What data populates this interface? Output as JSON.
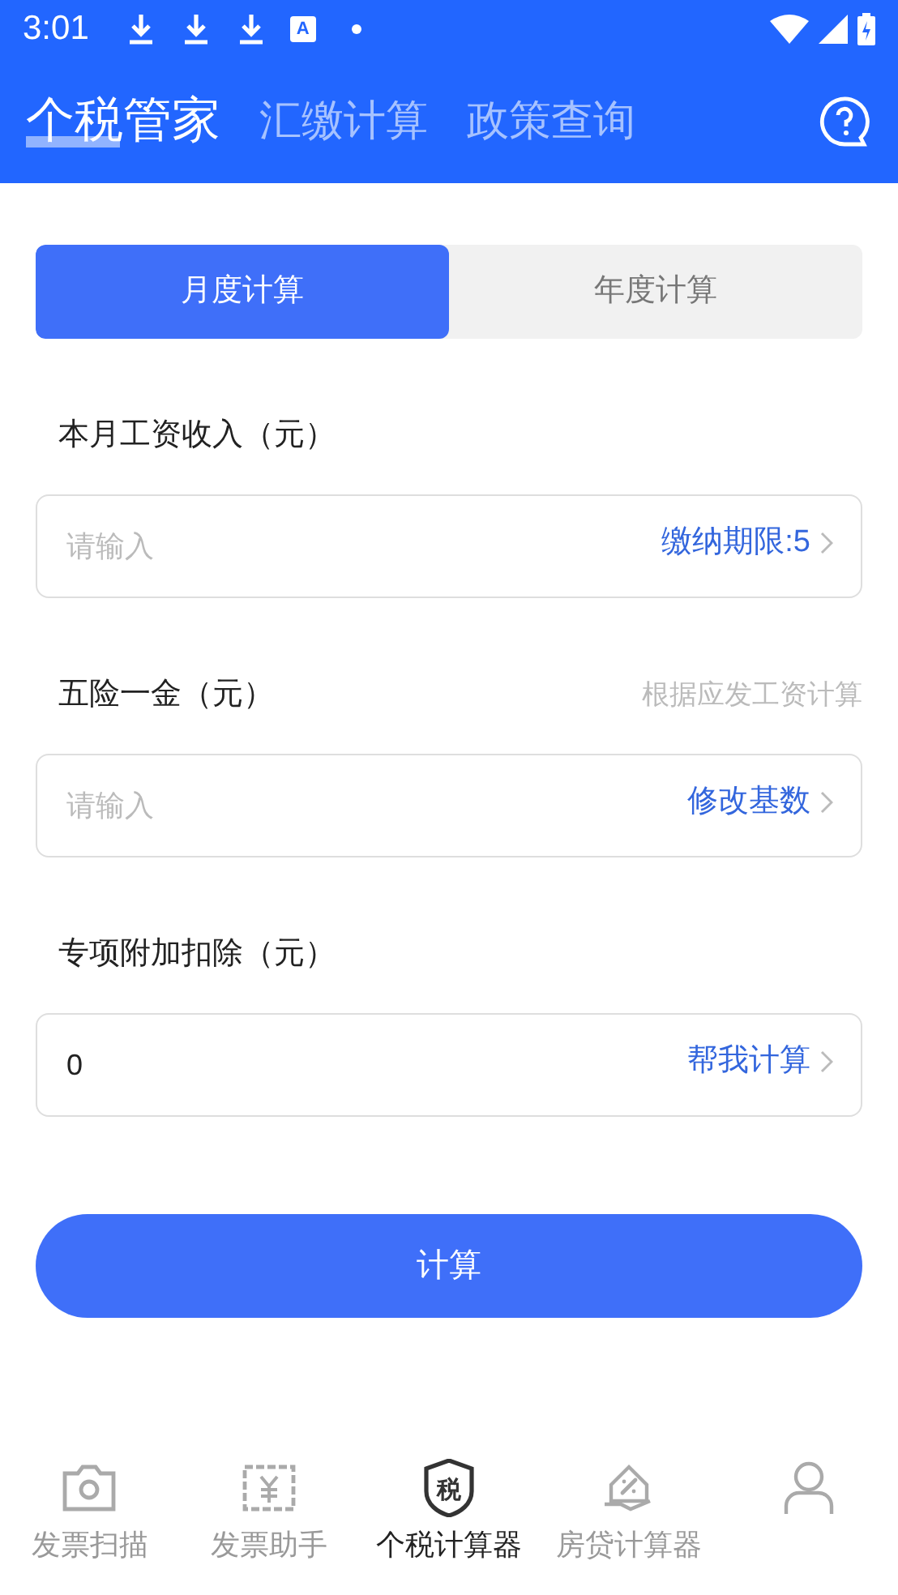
{
  "status_bar": {
    "time": "3:01",
    "notifications": [
      {
        "kind": "download"
      },
      {
        "kind": "download"
      },
      {
        "kind": "download"
      },
      {
        "kind": "app",
        "text": "A"
      },
      {
        "kind": "dot"
      }
    ]
  },
  "header": {
    "tabs": [
      {
        "label": "个税管家",
        "selected": true
      },
      {
        "label": "汇缴计算",
        "selected": false
      },
      {
        "label": "政策查询",
        "selected": false
      }
    ]
  },
  "mode_tabs": [
    {
      "label": "月度计算",
      "selected": true
    },
    {
      "label": "年度计算",
      "selected": false
    }
  ],
  "fields": [
    {
      "label": "本月工资收入（元）",
      "placeholder": "请输入",
      "action": "缴纳期限:5"
    },
    {
      "label": "五险一金（元）",
      "hint": "根据应发工资计算",
      "placeholder": "请输入",
      "action": "修改基数"
    },
    {
      "label": "专项附加扣除（元）",
      "value": "0",
      "action": "帮我计算"
    }
  ],
  "submit": "计算",
  "nav": [
    {
      "kind": "camera",
      "label": "发票扫描",
      "selected": false
    },
    {
      "kind": "ticket",
      "label": "发票助手",
      "selected": false
    },
    {
      "kind": "shield",
      "icon_text": "税",
      "label": "个税计算器",
      "selected": true
    },
    {
      "kind": "house",
      "label": "房贷计算器",
      "selected": false
    },
    {
      "kind": "person",
      "selected": false
    }
  ]
}
